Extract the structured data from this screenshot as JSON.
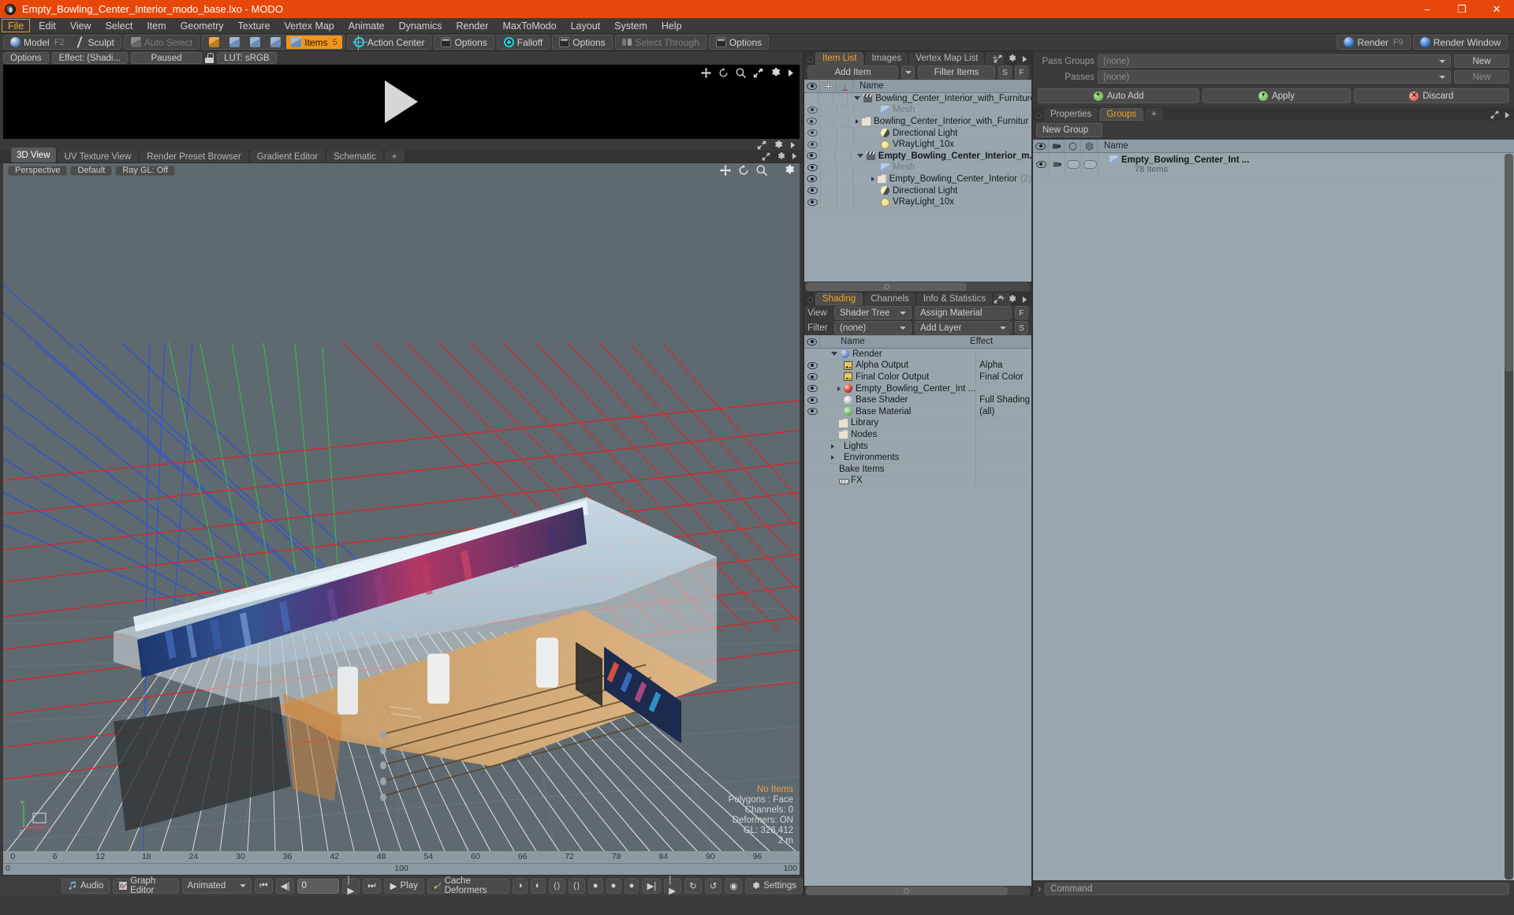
{
  "window": {
    "title": "Empty_Bowling_Center_Interior_modo_base.lxo - MODO",
    "minimize": "–",
    "maximize": "❐",
    "close": "✕"
  },
  "menu": {
    "items": [
      "File",
      "Edit",
      "View",
      "Select",
      "Item",
      "Geometry",
      "Texture",
      "Vertex Map",
      "Animate",
      "Dynamics",
      "Render",
      "MaxToModo",
      "Layout",
      "System",
      "Help"
    ],
    "active": "File"
  },
  "modebar": {
    "model": "Model",
    "model_key": "F2",
    "sculpt": "Sculpt",
    "auto_select": "Auto Select",
    "items": "Items",
    "items_key": "5",
    "action_center": "Action Center",
    "options1": "Options",
    "falloff": "Falloff",
    "options2": "Options",
    "select_through": "Select Through",
    "options3": "Options",
    "render": "Render",
    "render_key": "F9",
    "render_window": "Render Window"
  },
  "render_preview": {
    "options": "Options",
    "effect": "Effect: (Shadi...",
    "paused": "Paused",
    "lut": "LUT: sRGB"
  },
  "viewport_tabs": {
    "tabs": [
      "3D View",
      "UV Texture View",
      "Render Preset Browser",
      "Gradient Editor",
      "Schematic"
    ],
    "selected": "3D View",
    "add": "+"
  },
  "viewport": {
    "perspective": "Perspective",
    "shading_style": "Default",
    "raygl": "Ray GL: Off",
    "stats": {
      "no_items": "No Items",
      "polygons": "Polygons : Face",
      "channels": "Channels: 0",
      "deformers": "Deformers: ON",
      "gl": "GL: 326,412",
      "scale": "2 m"
    },
    "axis": {
      "y": "Y",
      "x": "X",
      "z": "Z"
    }
  },
  "timeline": {
    "ticks": [
      "0",
      "6",
      "12",
      "18",
      "24",
      "30",
      "36",
      "42",
      "48",
      "54",
      "60",
      "66",
      "72",
      "78",
      "84",
      "90",
      "96"
    ],
    "range_start": "0",
    "range_mid": "100",
    "range_end": "100"
  },
  "bottombar": {
    "audio": "Audio",
    "graph_editor": "Graph Editor",
    "mode": "Animated",
    "frame": "0",
    "play": "Play",
    "cache_deformers": "Cache Deformers",
    "settings": "Settings"
  },
  "item_list": {
    "tabs": [
      "Item List",
      "Images",
      "Vertex Map List"
    ],
    "selected_tab": "Item List",
    "add_tab": "+",
    "add_item": "Add Item",
    "filter_items": "Filter Items",
    "btn_s": "S",
    "btn_f": "F",
    "columns": [
      "Name"
    ],
    "rows": [
      {
        "name": "Bowling_Center_Interior_with_Furniture_ ...",
        "icon": "slate-icon",
        "indent": 0,
        "expander": "down",
        "eye": false,
        "bold": false,
        "dim": false
      },
      {
        "name": "Mesh",
        "icon": "mesh-icon",
        "indent": 1,
        "expander": "none",
        "eye": true,
        "bold": false,
        "dim": true
      },
      {
        "name": "Bowling_Center_Interior_with_Furnitur ...",
        "icon": "folder-icon",
        "indent": 1,
        "expander": "right",
        "eye": true,
        "bold": false,
        "dim": false
      },
      {
        "name": "Directional Light",
        "icon": "dirlight-icon",
        "indent": 1,
        "expander": "none",
        "eye": true,
        "bold": false,
        "dim": false
      },
      {
        "name": "VRayLight_10x",
        "icon": "vraylight-icon",
        "indent": 1,
        "expander": "none",
        "eye": true,
        "bold": false,
        "dim": false
      },
      {
        "name": "Empty_Bowling_Center_Interior_m...",
        "icon": "slate-icon",
        "indent": 0,
        "expander": "down",
        "eye": true,
        "bold": true,
        "dim": false
      },
      {
        "name": "Mesh",
        "icon": "mesh-icon",
        "indent": 1,
        "expander": "none",
        "eye": true,
        "bold": false,
        "dim": true
      },
      {
        "name": "Empty_Bowling_Center_Interior",
        "suffix": "(2)",
        "icon": "folder-icon",
        "indent": 1,
        "expander": "right",
        "eye": true,
        "bold": false,
        "dim": false
      },
      {
        "name": "Directional Light",
        "icon": "dirlight-icon",
        "indent": 1,
        "expander": "none",
        "eye": true,
        "bold": false,
        "dim": false
      },
      {
        "name": "VRayLight_10x",
        "icon": "vraylight-icon",
        "indent": 1,
        "expander": "none",
        "eye": true,
        "bold": false,
        "dim": false
      }
    ]
  },
  "shading": {
    "tabs": [
      "Shading",
      "Channels",
      "Info & Statistics"
    ],
    "selected_tab": "Shading",
    "add_tab": "+",
    "view_label": "View",
    "view_value": "Shader Tree",
    "assign_material": "Assign Material",
    "btn_f": "F",
    "filter_label": "Filter",
    "filter_value": "(none)",
    "add_layer": "Add Layer",
    "btn_s": "S",
    "col_name": "Name",
    "col_effect": "Effect",
    "rows": [
      {
        "name": "Render",
        "effect": "",
        "icon": "ball-blue-icon",
        "indent": 0,
        "expander": "down",
        "eye": false
      },
      {
        "name": "Alpha Output",
        "effect": "Alpha",
        "icon": "image-icon",
        "indent": 1,
        "expander": "none",
        "eye": true
      },
      {
        "name": "Final Color Output",
        "effect": "Final Color",
        "icon": "image-icon",
        "indent": 1,
        "expander": "none",
        "eye": true
      },
      {
        "name": "Empty_Bowling_Center_Int ...",
        "effect": "",
        "icon": "ball-red-icon",
        "indent": 1,
        "expander": "right",
        "eye": true
      },
      {
        "name": "Base Shader",
        "effect": "Full Shading",
        "icon": "ball-white-icon",
        "indent": 1,
        "expander": "none",
        "eye": true
      },
      {
        "name": "Base Material",
        "effect": "(all)",
        "icon": "ball-green-icon",
        "indent": 1,
        "expander": "none",
        "eye": true
      },
      {
        "name": "Library",
        "effect": "",
        "icon": "folder-icon",
        "indent": 0,
        "expander": "none",
        "eye": false
      },
      {
        "name": "Nodes",
        "effect": "",
        "icon": "folder-icon",
        "indent": 0,
        "expander": "none",
        "eye": false
      },
      {
        "name": "Lights",
        "effect": "",
        "icon": "none",
        "indent": 0,
        "expander": "right",
        "eye": false
      },
      {
        "name": "Environments",
        "effect": "",
        "icon": "none",
        "indent": 0,
        "expander": "right",
        "eye": false
      },
      {
        "name": "Bake Items",
        "effect": "",
        "icon": "none",
        "indent": 0,
        "expander": "none",
        "eye": false
      },
      {
        "name": "FX",
        "effect": "",
        "icon": "fx-icon",
        "indent": 0,
        "expander": "none",
        "eye": false
      }
    ]
  },
  "passes": {
    "pass_groups_label": "Pass Groups",
    "pass_groups_value": "(none)",
    "pass_groups_new": "New",
    "passes_label": "Passes",
    "passes_value": "(none)",
    "passes_new": "New",
    "auto_add": "Auto Add",
    "apply": "Apply",
    "discard": "Discard"
  },
  "groups": {
    "tabs": [
      "Properties",
      "Groups"
    ],
    "selected_tab": "Groups",
    "add_tab": "+",
    "new_group": "New Group",
    "col_name": "Name",
    "rows": [
      {
        "name": "Empty_Bowling_Center_Int ...",
        "sub": "78 Items",
        "plus": "+"
      }
    ]
  },
  "command": {
    "prompt": "›",
    "placeholder": "Command"
  },
  "colors": {
    "title_bar": "#e8470a",
    "accent": "#f5a623",
    "panel_bg": "#3a3a3a",
    "list_bg": "#9aa6ae",
    "viewport_bg": "#5e6a70"
  }
}
